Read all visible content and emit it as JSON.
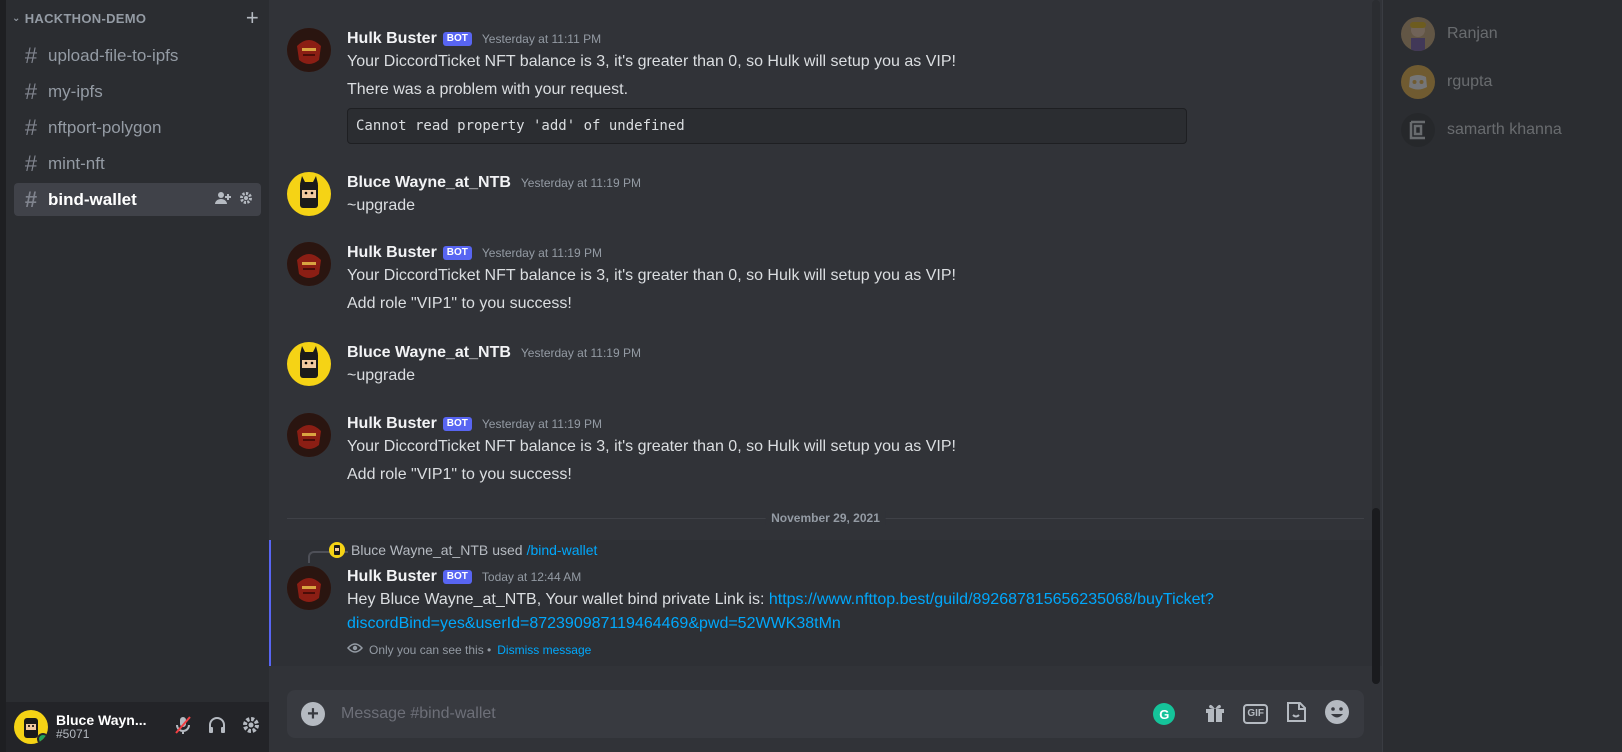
{
  "sidebar": {
    "category": "HACKTHON-DEMO",
    "channels": [
      {
        "name": "upload-file-to-ipfs"
      },
      {
        "name": "my-ipfs"
      },
      {
        "name": "nftport-polygon"
      },
      {
        "name": "mint-nft"
      },
      {
        "name": "bind-wallet"
      }
    ]
  },
  "user": {
    "name": "Bluce Wayn...",
    "discriminator": "#5071"
  },
  "messages": [
    {
      "author": "Hulk Buster",
      "bot_tag": "BOT",
      "timestamp": "Yesterday at 11:11 PM",
      "line1": "Your DiccordTicket NFT balance is 3, it's greater than 0, so Hulk will setup you as VIP!",
      "line2": "There was a problem with your request.",
      "code": "Cannot read property 'add' of undefined"
    },
    {
      "author": "Bluce Wayne_at_NTB",
      "timestamp": "Yesterday at 11:19 PM",
      "line1": "~upgrade"
    },
    {
      "author": "Hulk Buster",
      "bot_tag": "BOT",
      "timestamp": "Yesterday at 11:19 PM",
      "line1": "Your DiccordTicket NFT balance is 3, it's greater than 0, so Hulk will setup you as VIP!",
      "line2": "Add role \"VIP1\" to you success!"
    },
    {
      "author": "Bluce Wayne_at_NTB",
      "timestamp": "Yesterday at 11:19 PM",
      "line1": "~upgrade"
    },
    {
      "author": "Hulk Buster",
      "bot_tag": "BOT",
      "timestamp": "Yesterday at 11:19 PM",
      "line1": "Your DiccordTicket NFT balance is 3, it's greater than 0, so Hulk will setup you as VIP!",
      "line2": "Add role \"VIP1\" to you success!"
    }
  ],
  "date_divider": "November 29, 2021",
  "interaction": {
    "reply_user": "Bluce Wayne_at_NTB",
    "reply_used": "used",
    "reply_command": "/bind-wallet",
    "author": "Hulk Buster",
    "bot_tag": "BOT",
    "timestamp": "Today at 12:44 AM",
    "text": "Hey Bluce Wayne_at_NTB, Your wallet bind private Link is: ",
    "link_line1": "https://www.nfttop.best/guild/892687815656235068/buyTicket?",
    "link_line2": "discordBind=yes&userId=872390987119464469&pwd=52WWK38tMn",
    "ephemeral_note": "Only you can see this •",
    "dismiss": "Dismiss message"
  },
  "composer": {
    "placeholder": "Message #bind-wallet"
  },
  "members": [
    {
      "name": "Ranjan"
    },
    {
      "name": "rgupta"
    },
    {
      "name": "samarth khanna"
    }
  ],
  "colors": {
    "accent": "#5865f2",
    "link": "#00a8fc",
    "online": "#23a559"
  }
}
